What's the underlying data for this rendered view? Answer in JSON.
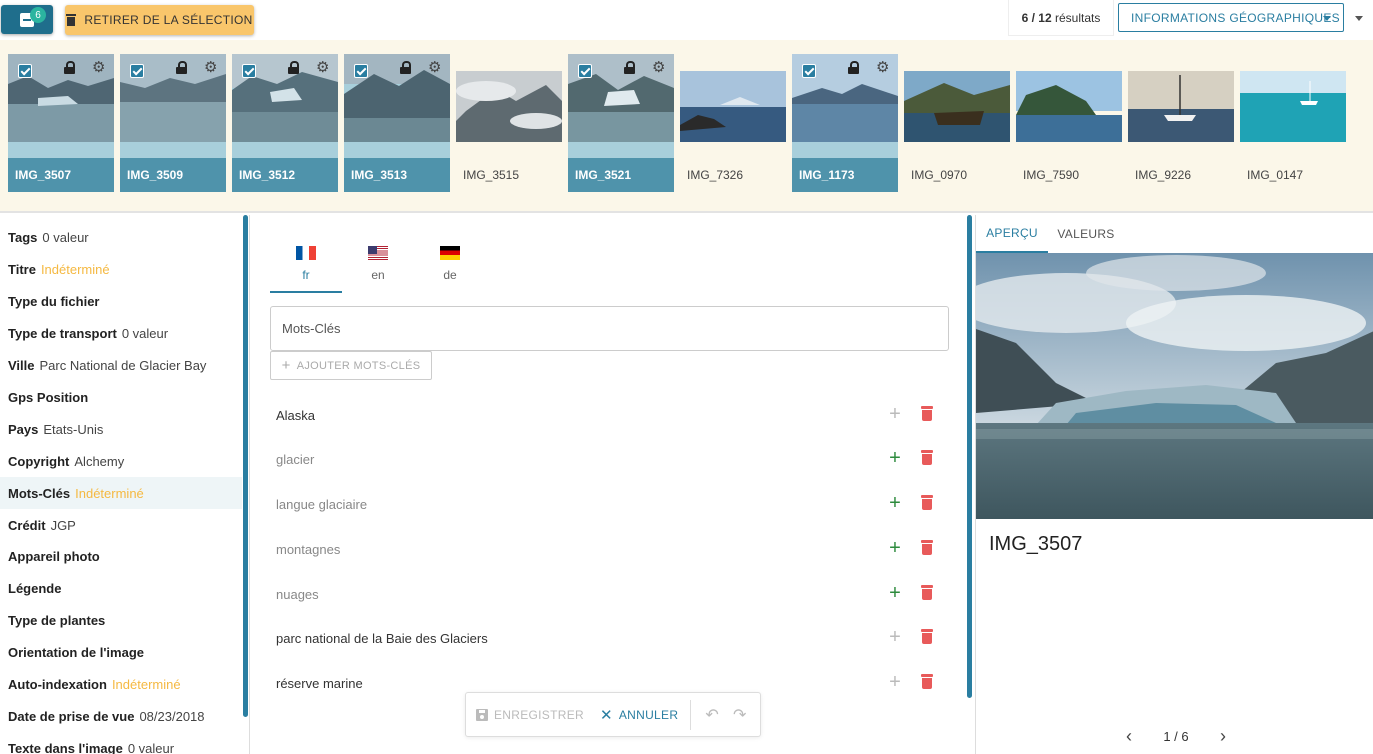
{
  "topbar": {
    "basket_count": "6",
    "remove_label": "RETIRER DE LA SÉLECTION",
    "results_current": "6 / 12",
    "results_suffix": "résultats",
    "geo_select": "INFORMATIONS GÉOGRAPHIQUES"
  },
  "thumbnails": [
    {
      "name": "IMG_3507",
      "selected": true
    },
    {
      "name": "IMG_3509",
      "selected": true
    },
    {
      "name": "IMG_3512",
      "selected": true
    },
    {
      "name": "IMG_3513",
      "selected": true
    },
    {
      "name": "IMG_3515",
      "selected": false
    },
    {
      "name": "IMG_3521",
      "selected": true
    },
    {
      "name": "IMG_7326",
      "selected": false
    },
    {
      "name": "IMG_1173",
      "selected": true
    },
    {
      "name": "IMG_0970",
      "selected": false
    },
    {
      "name": "IMG_7590",
      "selected": false
    },
    {
      "name": "IMG_9226",
      "selected": false
    },
    {
      "name": "IMG_0147",
      "selected": false
    }
  ],
  "properties": [
    {
      "key": "Tags",
      "value": "0 valeur",
      "indeterminate": false
    },
    {
      "key": "Titre",
      "value": "Indéterminé",
      "indeterminate": true
    },
    {
      "key": "Type du fichier",
      "value": "",
      "indeterminate": false
    },
    {
      "key": "Type de transport",
      "value": "0 valeur",
      "indeterminate": false
    },
    {
      "key": "Ville",
      "value": "Parc National de Glacier Bay",
      "indeterminate": false
    },
    {
      "key": "Gps Position",
      "value": "",
      "indeterminate": false
    },
    {
      "key": "Pays",
      "value": "Etats-Unis",
      "indeterminate": false
    },
    {
      "key": "Copyright",
      "value": "Alchemy",
      "indeterminate": false
    },
    {
      "key": "Mots-Clés",
      "value": "Indéterminé",
      "indeterminate": true
    },
    {
      "key": "Crédit",
      "value": "JGP",
      "indeterminate": false
    },
    {
      "key": "Appareil photo",
      "value": "",
      "indeterminate": false
    },
    {
      "key": "Légende",
      "value": "",
      "indeterminate": false
    },
    {
      "key": "Type de plantes",
      "value": "",
      "indeterminate": false
    },
    {
      "key": "Orientation de l'image",
      "value": "",
      "indeterminate": false
    },
    {
      "key": "Auto-indexation",
      "value": "Indéterminé",
      "indeterminate": true
    },
    {
      "key": "Date de prise de vue",
      "value": "08/23/2018",
      "indeterminate": false
    },
    {
      "key": "Texte dans l'image",
      "value": "0 valeur",
      "indeterminate": false
    }
  ],
  "editor": {
    "languages": [
      {
        "code": "fr",
        "flag": "flag-fr"
      },
      {
        "code": "en",
        "flag": "flag-us"
      },
      {
        "code": "de",
        "flag": "flag-de"
      }
    ],
    "field_label": "Mots-Clés",
    "add_label": "AJOUTER MOTS-CLÉS",
    "keywords": [
      {
        "text": "Alaska",
        "partial": false
      },
      {
        "text": "glacier",
        "partial": true
      },
      {
        "text": "langue glaciaire",
        "partial": true
      },
      {
        "text": "montagnes",
        "partial": true
      },
      {
        "text": "nuages",
        "partial": true
      },
      {
        "text": "parc national de la Baie des Glaciers",
        "partial": false
      },
      {
        "text": "réserve marine",
        "partial": false
      }
    ],
    "save_label": "ENREGISTRER",
    "cancel_label": "ANNULER"
  },
  "preview": {
    "tab_preview": "APERÇU",
    "tab_values": "VALEURS",
    "title": "IMG_3507",
    "pager": "1 / 6"
  },
  "colors": {
    "accent": "#2a7ea1",
    "selected_label_bg": "#4f93ab",
    "indeterminate": "#f5b942",
    "remove_button": "#f9c66b",
    "add_green": "#2e8b3e",
    "delete_red": "#e85a5a"
  }
}
